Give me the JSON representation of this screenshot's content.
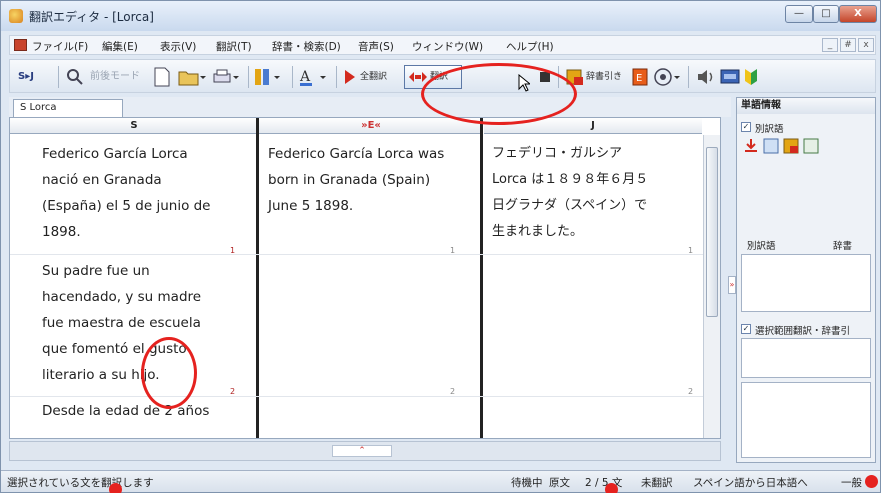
{
  "window": {
    "title": "翻訳エディタ - [Lorca]",
    "min": "—",
    "max": "□",
    "close": "X"
  },
  "menu": {
    "items": [
      "ファイル(F)",
      "編集(E)",
      "表示(V)",
      "翻訳(T)",
      "辞書・検索(D)",
      "音声(S)",
      "ウィンドウ(W)",
      "ヘルプ(H)"
    ],
    "mdi_min": "_",
    "mdi_restore": "#",
    "mdi_close": "x"
  },
  "toolbar": {
    "lang_toggle": "S▸J",
    "search_mode": "前後モード",
    "translate_all": "全翻訳",
    "translate": "翻訳",
    "dict_lookup": "辞書引き"
  },
  "tab": {
    "label": "S  Lorca"
  },
  "columns": [
    {
      "label": "S",
      "color": "#222222"
    },
    {
      "label": "»E«",
      "color": "#c33333"
    },
    {
      "label": "J",
      "color": "#222222"
    }
  ],
  "rows": [
    {
      "source": [
        "Federico García Lorca",
        "nació en Granada",
        "(España) el 5 de junio de",
        "1898."
      ],
      "english": [
        "Federico García Lorca was",
        "born in Granada (Spain)",
        "June 5 1898."
      ],
      "japanese": [
        "フェデリコ・ガルシア",
        "Lorca は１８９８年６月５",
        "日グラナダ（スペイン）で",
        "生まれました。"
      ],
      "num": "1"
    },
    {
      "source": [
        "Su padre fue un",
        "hacendado, y su madre",
        "fue maestra de escuela",
        "que fomentó el gusto",
        "literario a su hijo."
      ],
      "english": [],
      "japanese": [],
      "num": "2"
    },
    {
      "source": [
        "Desde la edad de 2 años"
      ],
      "english": [],
      "japanese": [],
      "num": ""
    }
  ],
  "side": {
    "header": "単語情報",
    "alt_words_check": "別訳語",
    "alt_words_label": "別訳語",
    "dict_label": "辞書",
    "selection_check": "選択範囲翻訳・辞書引"
  },
  "status": {
    "hint": "選択されている文を翻訳します",
    "state": "待機中",
    "mode": "原文",
    "position": "2 / 5 文",
    "untranslated": "未翻訳",
    "direction": "スペイン語から日本語へ",
    "field": "一般"
  },
  "colors": {
    "accent": "#e5221f",
    "chrome": "#dfe8f3"
  }
}
